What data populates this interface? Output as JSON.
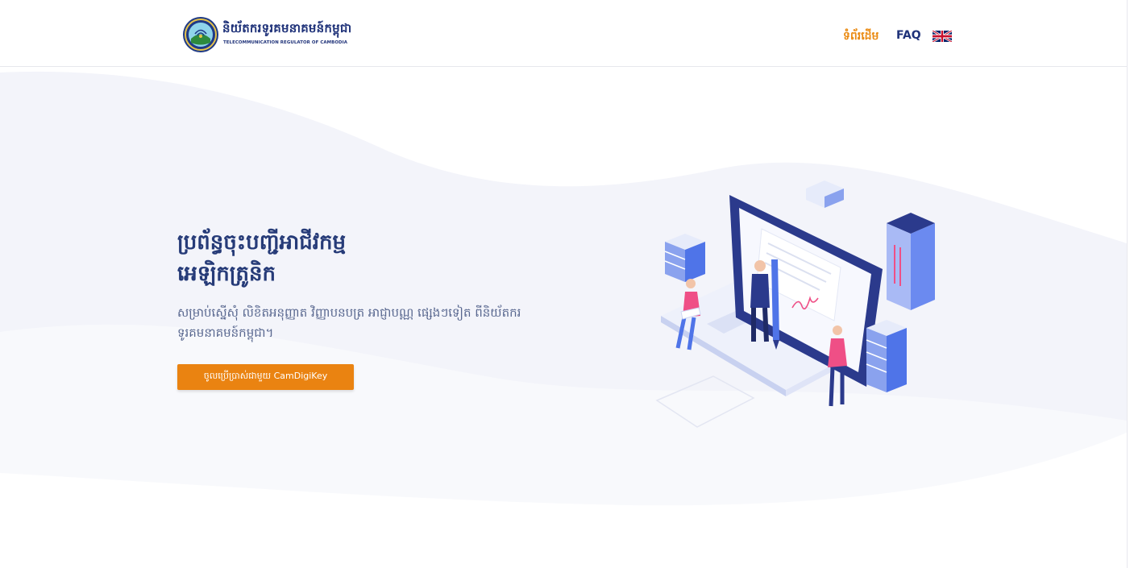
{
  "header": {
    "brand_kh": "និយ័តករទូរគមនាគមន៍កម្ពុជា",
    "brand_en": "TELECOMMUNICATION REGULATOR OF CAMBODIA",
    "nav": {
      "home": "ទំព័រដើម",
      "faq": "FAQ"
    },
    "language_icon": "uk-flag-icon"
  },
  "hero": {
    "title_line1": "ប្រព័ន្ធចុះបញ្ជីអាជីវកម្ម",
    "title_line2": "អេឡិកត្រូនិក",
    "description": "សម្រាប់ស្នើសុំ លិខិតអនុញ្ញាត វិញ្ញាបនបត្រ អាជ្ញាបណ្ណ ផ្សេងៗទៀត ពីនិយ័តករទូរគមនាគមន៍កម្ពុជា។",
    "cta_label": "ចូលប្រើប្រាស់ជាមួយ CamDigiKey"
  },
  "colors": {
    "brand_navy": "#1f3279",
    "accent_orange": "#ea8311",
    "illustration_blue": "#4f74e8",
    "illustration_pink": "#ef4f86"
  }
}
